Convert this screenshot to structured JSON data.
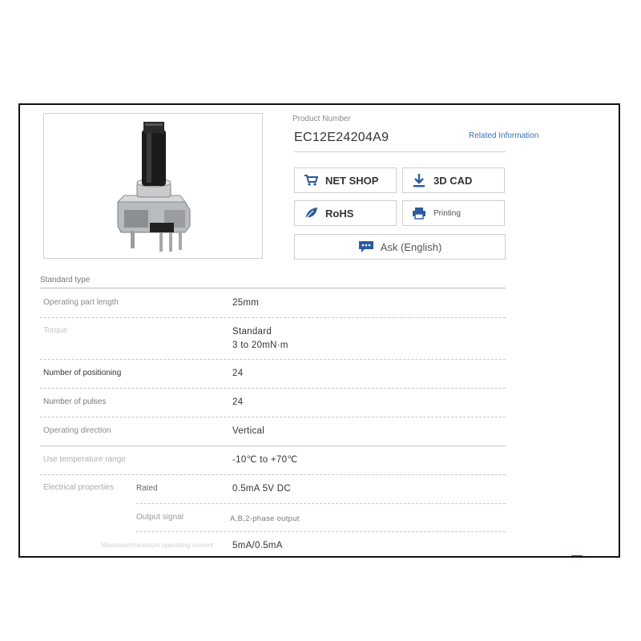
{
  "product": {
    "image_alt": "Rotary encoder with black shaft",
    "number_label": "Product Number",
    "number": "EC12E24204A9",
    "related_link": "Related Information"
  },
  "actions": {
    "net_shop": "NET SHOP",
    "cad": "3D CAD",
    "rohs": "RoHS",
    "printing": "Printing",
    "ask": "Ask (English)"
  },
  "specs": {
    "section_title": "Standard type",
    "operating_part_length": {
      "label": "Operating part length",
      "value": "25mm"
    },
    "torque": {
      "label": "Torque",
      "value_line1": "Standard",
      "value_line2": "3 to 20mN·m"
    },
    "positioning": {
      "label": "Number of positioning",
      "value": "24"
    },
    "pulses": {
      "label": "Number of pulses",
      "value": "24"
    },
    "direction": {
      "label": "Operating direction",
      "value": "Vertical"
    },
    "temperature": {
      "label": "Use temperature range",
      "value": "-10℃ to +70℃"
    },
    "electrical": {
      "label": "Electrical properties",
      "rated_label": "Rated",
      "rated_value": "0.5mA 5V DC",
      "output_label": "Output signal",
      "output_value": "A,B,2-phase output",
      "current_label": "Maximum/minimum operating current",
      "current_value": "5mA/0.5mA"
    }
  },
  "colors": {
    "link": "#3b6fb0",
    "icon_blue": "#2a5a9e",
    "badge_red": "#d22"
  }
}
